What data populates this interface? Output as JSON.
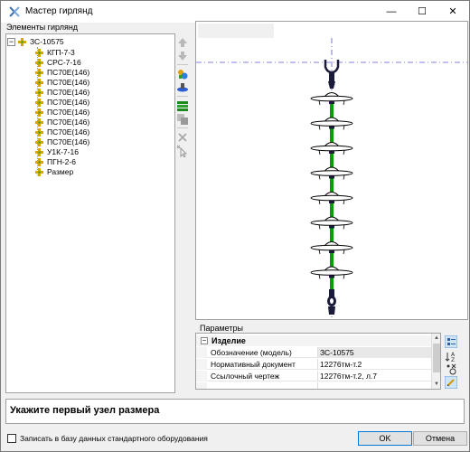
{
  "window": {
    "title": "Мастер гирлянд",
    "minimize_glyph": "—",
    "maximize_glyph": "☐",
    "close_glyph": "✕"
  },
  "tree": {
    "group_label": "Элементы гирлянд",
    "root": {
      "label": "ЗС-10575",
      "expander": "−"
    },
    "items": [
      {
        "label": "КГП-7-3"
      },
      {
        "label": "СРС-7-16"
      },
      {
        "label": "ПС70Е(146)"
      },
      {
        "label": "ПС70Е(146)"
      },
      {
        "label": "ПС70Е(146)"
      },
      {
        "label": "ПС70Е(146)"
      },
      {
        "label": "ПС70Е(146)"
      },
      {
        "label": "ПС70Е(146)"
      },
      {
        "label": "ПС70Е(146)"
      },
      {
        "label": "ПС70Е(146)"
      },
      {
        "label": "У1К-7-16"
      },
      {
        "label": "ПГН-2-6"
      },
      {
        "label": "Размер"
      }
    ]
  },
  "toolbar": {
    "icons": [
      "move-up-icon",
      "move-down-icon",
      "add-element-icon",
      "insert-element-icon",
      "multiply-icon",
      "copy-icon",
      "delete-icon",
      "pick-node-icon"
    ]
  },
  "preview": {
    "insulator_count": 8,
    "colors": {
      "insulator_outline": "#000000",
      "connector": "#00a000",
      "axis": "#5a5ad2",
      "fitting": "#1a1a3a"
    }
  },
  "params": {
    "label": "Параметры",
    "category": {
      "title": "Изделие",
      "expander": "−"
    },
    "rows": [
      {
        "name": "Обозначение (модель)",
        "value": "ЗС-10575"
      },
      {
        "name": "Нормативный документ",
        "value": "12276тм-т.2"
      },
      {
        "name": "Ссылочный чертеж",
        "value": "12276тм-т.2, л.7"
      },
      {
        "name": "",
        "value": ""
      }
    ],
    "scroll_up": "▲",
    "scroll_down": "▼"
  },
  "message": {
    "text": "Укажите первый узел размера"
  },
  "footer": {
    "checkbox_label": "Записать в базу данных стандартного оборудования",
    "checkbox_checked": false,
    "ok_label": "OK",
    "cancel_label": "Отмена"
  }
}
